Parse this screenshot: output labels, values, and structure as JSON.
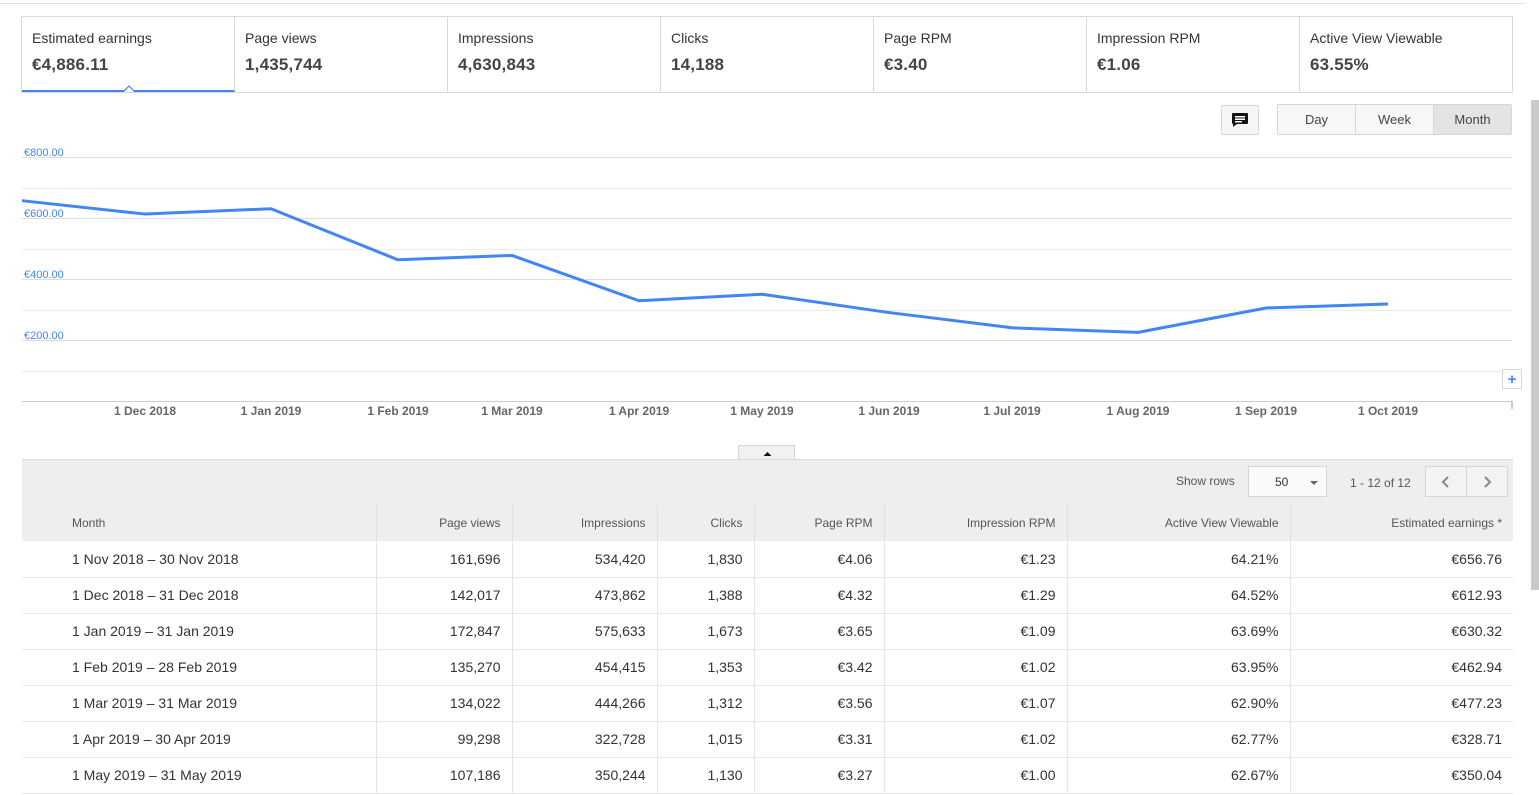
{
  "metrics": [
    {
      "label": "Estimated earnings",
      "value": "€4,886.11",
      "active": true
    },
    {
      "label": "Page views",
      "value": "1,435,744"
    },
    {
      "label": "Impressions",
      "value": "4,630,843"
    },
    {
      "label": "Clicks",
      "value": "14,188"
    },
    {
      "label": "Page RPM",
      "value": "€3.40"
    },
    {
      "label": "Impression RPM",
      "value": "€1.06"
    },
    {
      "label": "Active View Viewable",
      "value": "63.55%"
    }
  ],
  "period_options": [
    "Day",
    "Week",
    "Month"
  ],
  "period_selected": "Month",
  "icons": {
    "comment": "comment-icon",
    "plus": "plus-icon",
    "collapse": "caret-up-icon",
    "prev": "chevron-left-icon",
    "next": "chevron-right-icon"
  },
  "colors": {
    "line": "#4285f4",
    "axis_label": "#4285f4"
  },
  "chart_data": {
    "type": "line",
    "x": [
      "Nov 2018",
      "Dec 2018",
      "Jan 2019",
      "Feb 2019",
      "Mar 2019",
      "Apr 2019",
      "May 2019",
      "Jun 2019",
      "Jul 2019",
      "Aug 2019",
      "Sep 2019",
      "Oct 2019"
    ],
    "values": [
      656.76,
      612.93,
      630.32,
      462.94,
      477.23,
      328.71,
      350.04,
      290,
      240,
      225,
      305,
      318
    ],
    "y_ticks": [
      "€800.00",
      "€600.00",
      "€400.00",
      "€200.00"
    ],
    "x_ticks": [
      "1 Dec 2018",
      "1 Jan 2019",
      "1 Feb 2019",
      "1 Mar 2019",
      "1 Apr 2019",
      "1 May 2019",
      "1 Jun 2019",
      "1 Jul 2019",
      "1 Aug 2019",
      "1 Sep 2019",
      "1 Oct 2019"
    ],
    "ylim": [
      0,
      800
    ],
    "grid": true
  },
  "table": {
    "show_rows_label": "Show rows",
    "rows_per_page": "50",
    "range_label": "1 - 12 of 12",
    "headers": [
      "Month",
      "Page views",
      "Impressions",
      "Clicks",
      "Page RPM",
      "Impression RPM",
      "Active View Viewable",
      "Estimated earnings *"
    ],
    "rows": [
      [
        "1 Nov 2018 – 30 Nov 2018",
        "161,696",
        "534,420",
        "1,830",
        "€4.06",
        "€1.23",
        "64.21%",
        "€656.76"
      ],
      [
        "1 Dec 2018 – 31 Dec 2018",
        "142,017",
        "473,862",
        "1,388",
        "€4.32",
        "€1.29",
        "64.52%",
        "€612.93"
      ],
      [
        "1 Jan 2019 – 31 Jan 2019",
        "172,847",
        "575,633",
        "1,673",
        "€3.65",
        "€1.09",
        "63.69%",
        "€630.32"
      ],
      [
        "1 Feb 2019 – 28 Feb 2019",
        "135,270",
        "454,415",
        "1,353",
        "€3.42",
        "€1.02",
        "63.95%",
        "€462.94"
      ],
      [
        "1 Mar 2019 – 31 Mar 2019",
        "134,022",
        "444,266",
        "1,312",
        "€3.56",
        "€1.07",
        "62.90%",
        "€477.23"
      ],
      [
        "1 Apr 2019 – 30 Apr 2019",
        "99,298",
        "322,728",
        "1,015",
        "€3.31",
        "€1.02",
        "62.77%",
        "€328.71"
      ],
      [
        "1 May 2019 – 31 May 2019",
        "107,186",
        "350,244",
        "1,130",
        "€3.27",
        "€1.00",
        "62.67%",
        "€350.04"
      ]
    ]
  }
}
